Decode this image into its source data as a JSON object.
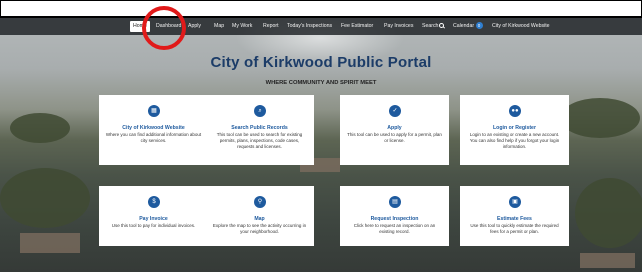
{
  "nav": {
    "home": "Home",
    "items": [
      "Dashboard",
      "Apply",
      "Map",
      "My Work",
      "Report",
      "Today's Inspections",
      "Fee Estimator",
      "Pay Invoices",
      "Search",
      "Calendar",
      "City of Kirkwood Website"
    ],
    "calendar_badge": "0"
  },
  "hero": {
    "title": "City of Kirkwood Public Portal",
    "subtitle": "WHERE COMMUNITY AND SPIRIT MEET"
  },
  "cards": [
    {
      "icon": "building-icon",
      "title": "City of Kirkwood Website",
      "desc": "Where you can find additional information about city services."
    },
    {
      "icon": "search-icon",
      "title": "Search Public Records",
      "desc": "This tool can be used to search for existing permits, plans, inspections, code cases, requests and licenses."
    },
    {
      "icon": "clipboard-check-icon",
      "title": "Apply",
      "desc": "This tool can be used to apply for a permit, plan or license."
    },
    {
      "icon": "users-icon",
      "title": "Login or Register",
      "desc": "Login to an existing or create a new account. You can also find help if you forgot your login information."
    },
    {
      "icon": "dollar-icon",
      "title": "Pay Invoice",
      "desc": "Use this tool to pay for individual invoices."
    },
    {
      "icon": "map-pin-icon",
      "title": "Map",
      "desc": "Explore the map to see the activity occurring in your neighborhood."
    },
    {
      "icon": "calendar-icon",
      "title": "Request Inspection",
      "desc": "Click here to request an inspection on an existing record."
    },
    {
      "icon": "calculator-icon",
      "title": "Estimate Fees",
      "desc": "Use this tool to quickly estimate the required fees for a permit or plan."
    }
  ],
  "colors": {
    "accent": "#1e5a9e",
    "annotation": "#e11a1a",
    "title": "#1c3c68"
  }
}
